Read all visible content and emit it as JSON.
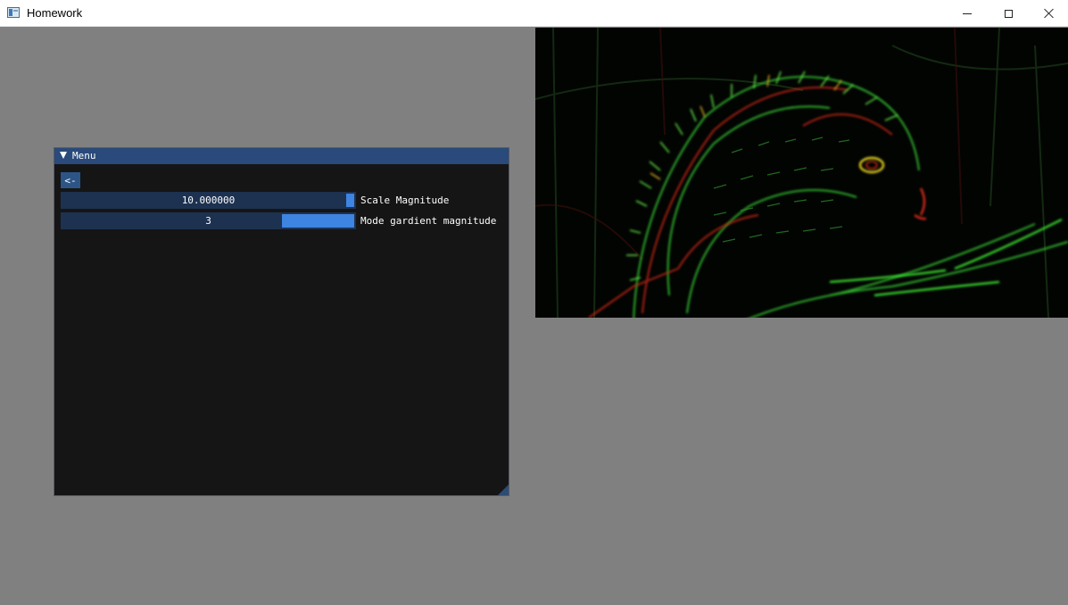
{
  "window": {
    "title": "Homework",
    "controls": [
      "minimize-icon",
      "maximize-icon",
      "close-icon"
    ]
  },
  "menu": {
    "title": "Menu",
    "back_label": "<-",
    "sliders": [
      {
        "value": "10.000000",
        "label": "Scale Magnitude",
        "level": 1.0
      },
      {
        "value": "3",
        "label": "Mode gardient magnitude",
        "level": 1.0
      }
    ]
  },
  "colors": {
    "background": "#808080",
    "panel_bg": "#151515",
    "title_bg": "#294a7a",
    "slider_bg": "#1d3251",
    "slider_grab": "#3d85e0",
    "edge_green": "#2dd32d",
    "edge_red": "#d62a1a"
  },
  "image": {
    "description_icon": "squirrel-edge-detection-image"
  }
}
